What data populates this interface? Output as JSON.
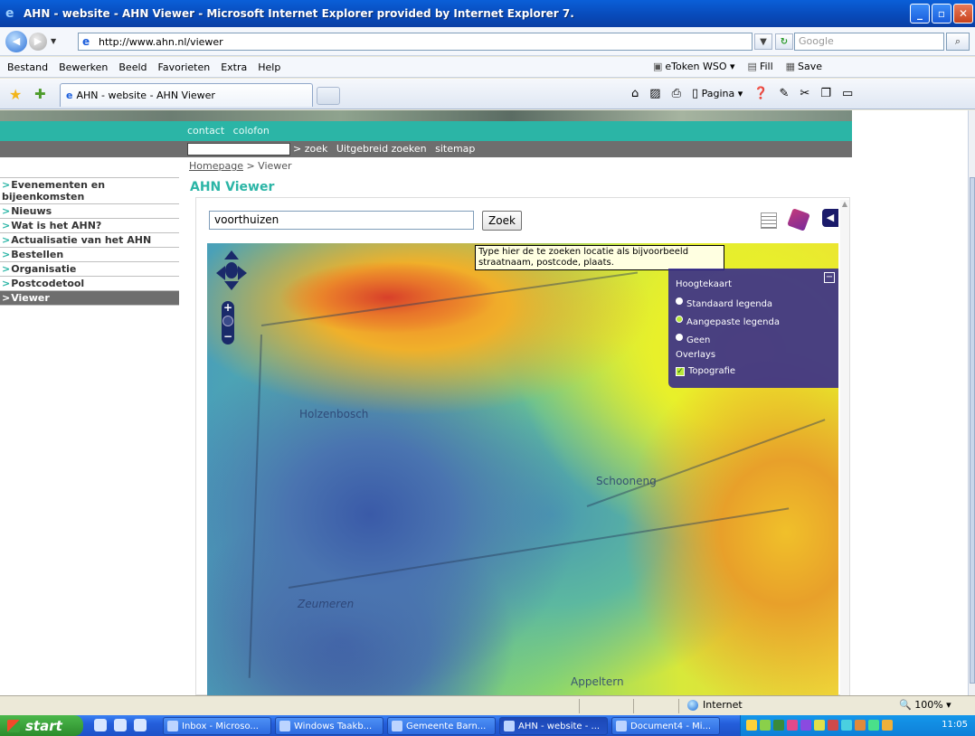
{
  "window": {
    "title": "AHN - website - AHN Viewer - Microsoft Internet Explorer provided by Internet Explorer 7."
  },
  "address_bar": {
    "url": "http://www.ahn.nl/viewer",
    "search_placeholder": "Google"
  },
  "menu": {
    "items": [
      "Bestand",
      "Bewerken",
      "Beeld",
      "Favorieten",
      "Extra",
      "Help"
    ],
    "links": [
      "eToken WSO",
      "Fill",
      "Save"
    ]
  },
  "tabs": {
    "active_label": "AHN - website - AHN Viewer"
  },
  "command_bar": {
    "page_label": "Pagina"
  },
  "site": {
    "top_links": [
      "contact",
      "colofon"
    ],
    "search_links": [
      "> zoek",
      "Uitgebreid zoeken",
      "sitemap"
    ],
    "breadcrumb_home": "Homepage",
    "breadcrumb_current": "> Viewer",
    "page_title": "AHN Viewer"
  },
  "sidebar": {
    "items": [
      {
        "label": "Evenementen en bijeenkomsten"
      },
      {
        "label": "Nieuws"
      },
      {
        "label": "Wat is het AHN?"
      },
      {
        "label": "Actualisatie van het AHN"
      },
      {
        "label": "Bestellen"
      },
      {
        "label": "Organisatie"
      },
      {
        "label": "Postcodetool"
      },
      {
        "label": "Viewer"
      }
    ],
    "active_index": 7
  },
  "viewer": {
    "location_value": "voorthuizen",
    "search_button": "Zoek",
    "tooltip": "Type hier de te zoeken locatie als bijvoorbeeld straatnaam, postcode, plaats.",
    "map_labels": [
      "Holzenbosch",
      "Schooneng",
      "Zeumeren",
      "Appeltern"
    ]
  },
  "layers": {
    "heading": "Hoogtekaart",
    "options": [
      {
        "label": "Standaard legenda",
        "selected": false
      },
      {
        "label": "Aangepaste legenda",
        "selected": true
      },
      {
        "label": "Geen",
        "selected": false
      }
    ],
    "overlays_heading": "Overlays",
    "overlays": [
      {
        "label": "Topografie",
        "checked": true
      }
    ]
  },
  "status_bar": {
    "zone": "Internet",
    "zoom": "100%"
  },
  "taskbar": {
    "start_label": "start",
    "tasks": [
      {
        "label": "Inbox - Microso..."
      },
      {
        "label": "Windows Taakb..."
      },
      {
        "label": "Gemeente Barn..."
      },
      {
        "label": "AHN - website - ..."
      },
      {
        "label": "Document4 - Mi..."
      }
    ],
    "clock": "11:05"
  },
  "colors": {
    "accent_teal": "#2bb5a6",
    "dark_grey": "#6e6e6e",
    "panel_purple": "#32288c"
  }
}
